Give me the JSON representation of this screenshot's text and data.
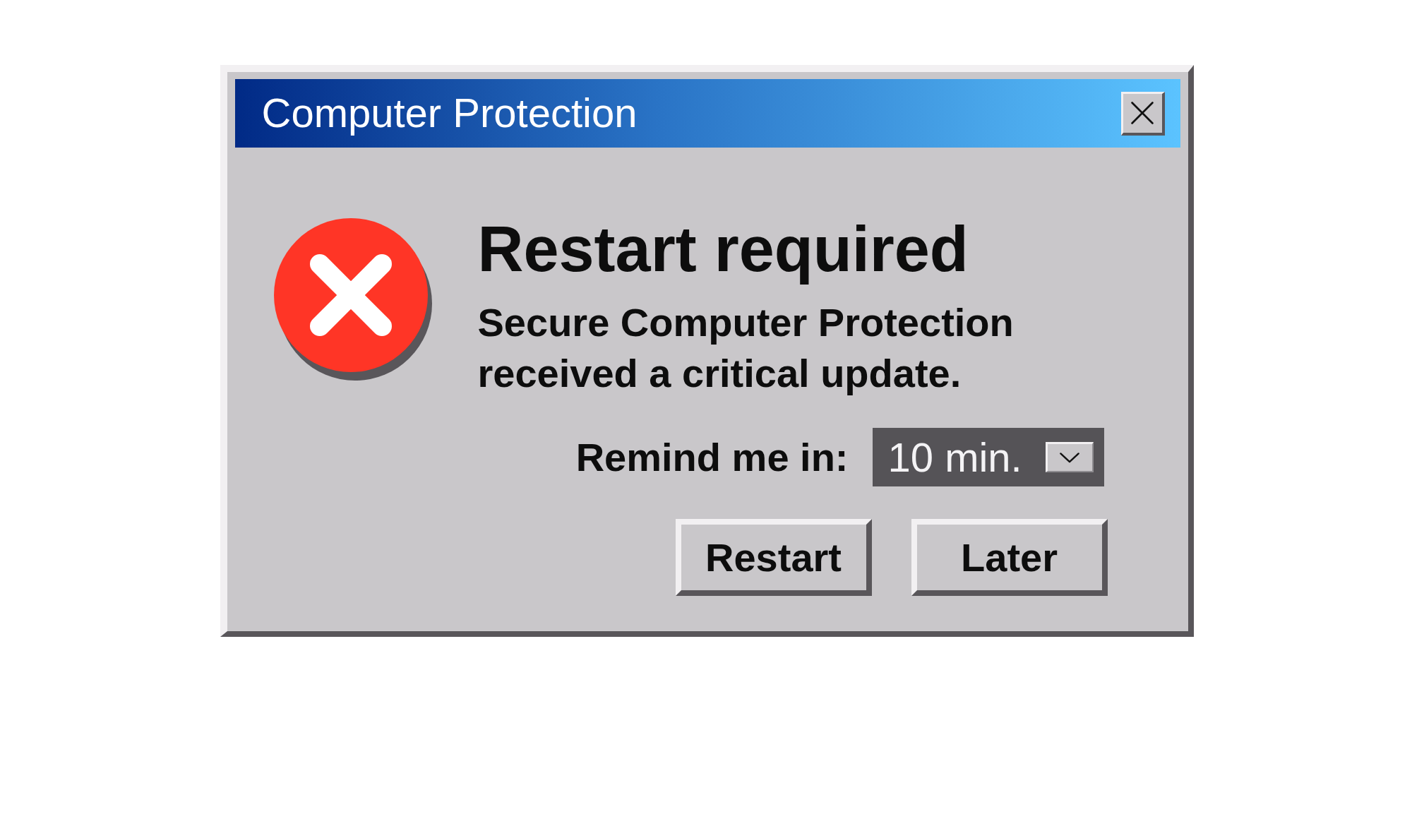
{
  "window": {
    "title": "Computer Protection"
  },
  "message": {
    "heading": "Restart required",
    "text": "Secure Computer Protection received a critical update."
  },
  "reminder": {
    "label": "Remind me in:",
    "value": "10 min."
  },
  "buttons": [
    "Restart",
    "Later"
  ]
}
